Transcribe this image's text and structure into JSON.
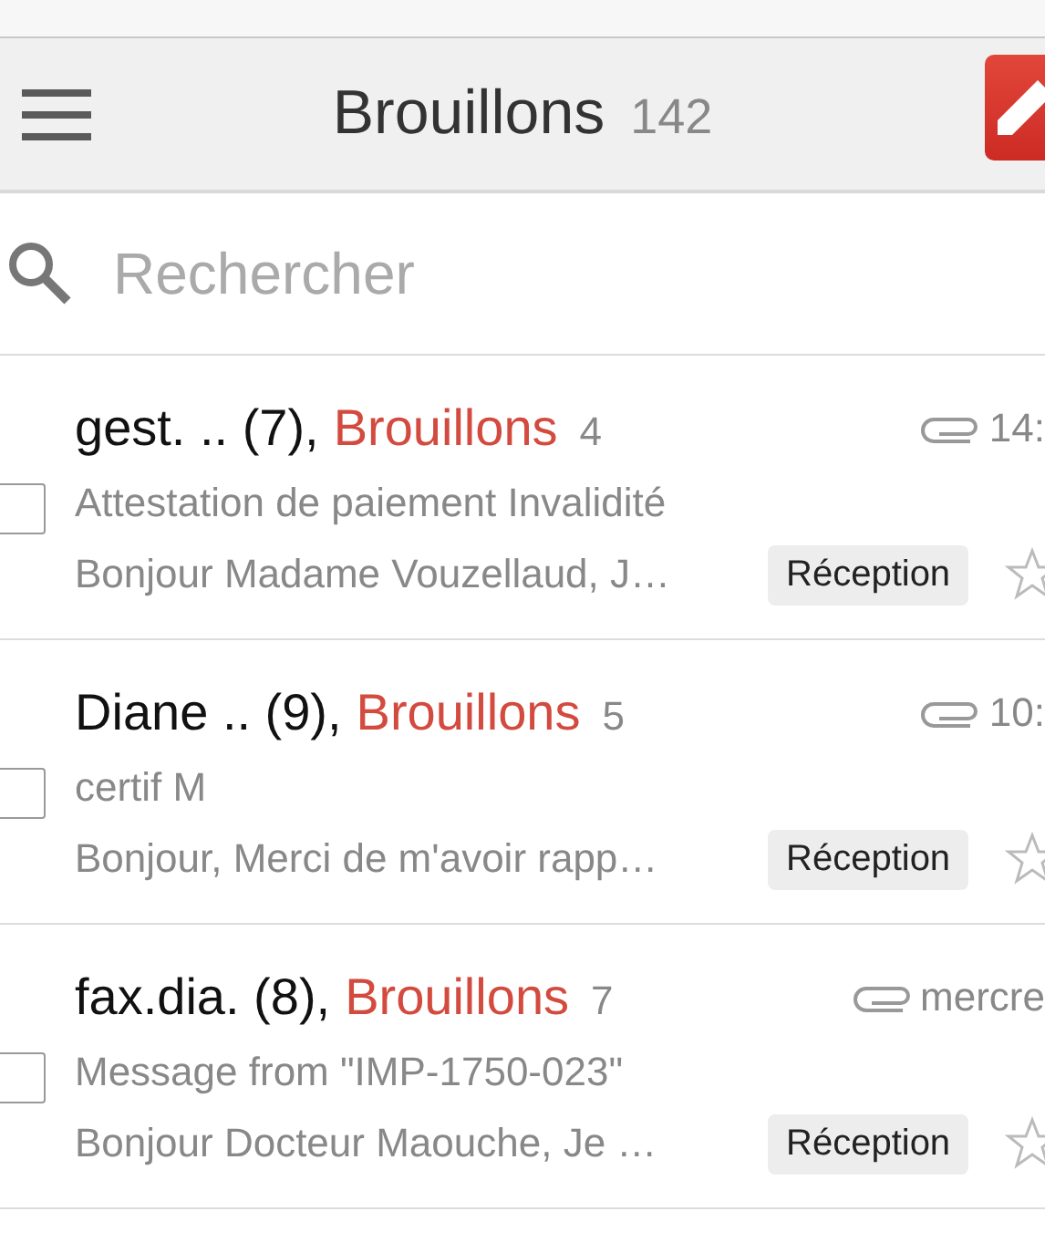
{
  "header": {
    "title": "Brouillons",
    "count": "142"
  },
  "search": {
    "placeholder": "Rechercher"
  },
  "messages": [
    {
      "sender": "gest. .. (7),",
      "folder": "Brouillons",
      "count": "4",
      "time": "14:",
      "attachment": true,
      "subject": "Attestation de paiement Invalidité",
      "preview": "Bonjour Madame Vouzellaud, J…",
      "label": "Réception",
      "checked": false,
      "starred": false
    },
    {
      "sender": "Diane .. (9),",
      "folder": "Brouillons",
      "count": "5",
      "time": "10:",
      "attachment": true,
      "subject": "certif M",
      "preview": "Bonjour, Merci de m'avoir rapp…",
      "label": "Réception",
      "checked": false,
      "starred": false
    },
    {
      "sender": "fax.dia. (8),",
      "folder": "Brouillons",
      "count": "7",
      "time": "mercre",
      "attachment": true,
      "subject": "Message from \"IMP-1750-023\"",
      "preview": "Bonjour Docteur Maouche, Je …",
      "label": "Réception",
      "checked": false,
      "starred": false
    }
  ]
}
